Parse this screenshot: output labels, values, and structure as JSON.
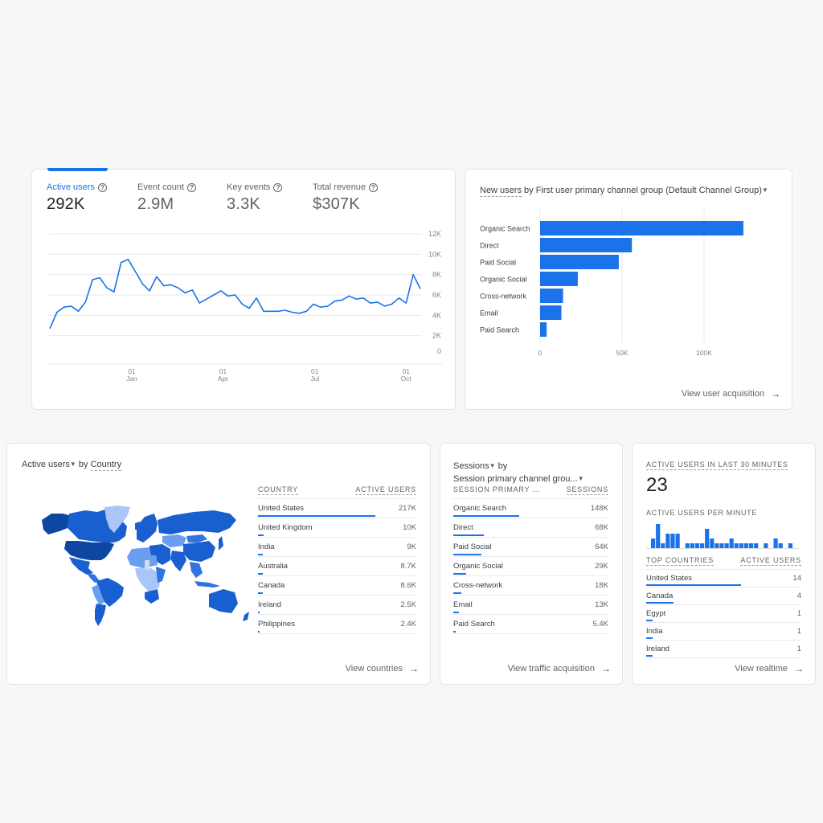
{
  "overview": {
    "metrics": [
      {
        "label": "Active users",
        "value": "292K",
        "active": true
      },
      {
        "label": "Event count",
        "value": "2.9M",
        "active": false
      },
      {
        "label": "Key events",
        "value": "3.3K",
        "active": false
      },
      {
        "label": "Total revenue",
        "value": "$307K",
        "active": false
      }
    ],
    "help_icon": "help-circle-icon"
  },
  "new_users_card": {
    "title_metric": "New users",
    "title_rest": " by First user primary channel group (Default Channel Group)",
    "view_link": "View user acquisition",
    "arrow_icon": "arrow-right-icon"
  },
  "country_card": {
    "title_metric": "Active users",
    "title_by": " by ",
    "title_dim": "Country",
    "col_country": "COUNTRY",
    "col_users": "ACTIVE USERS",
    "rows": [
      {
        "name": "United States",
        "value": "217K",
        "share": 1.0
      },
      {
        "name": "United Kingdom",
        "value": "10K",
        "share": 0.046
      },
      {
        "name": "India",
        "value": "9K",
        "share": 0.041
      },
      {
        "name": "Australia",
        "value": "8.7K",
        "share": 0.04
      },
      {
        "name": "Canada",
        "value": "8.6K",
        "share": 0.04
      },
      {
        "name": "Ireland",
        "value": "2.5K",
        "share": 0.012
      },
      {
        "name": "Philippines",
        "value": "2.4K",
        "share": 0.011
      }
    ],
    "view_link": "View countries",
    "map_colors": {
      "darkest": "#0d47a1",
      "dark": "#1a5fd0",
      "mid": "#2f74e0",
      "light": "#6c9ef0",
      "lighter": "#a9c6f7",
      "none": "#d7dbe0"
    }
  },
  "sessions_card": {
    "title_metric": "Sessions",
    "title_by": " by",
    "title_dim": "Session primary channel grou...",
    "col_dim": "SESSION PRIMARY ...",
    "col_val": "SESSIONS",
    "rows": [
      {
        "name": "Organic Search",
        "value": "148K",
        "share": 1.0
      },
      {
        "name": "Direct",
        "value": "68K",
        "share": 0.46
      },
      {
        "name": "Paid Social",
        "value": "64K",
        "share": 0.43
      },
      {
        "name": "Organic Social",
        "value": "29K",
        "share": 0.2
      },
      {
        "name": "Cross-network",
        "value": "18K",
        "share": 0.12
      },
      {
        "name": "Email",
        "value": "13K",
        "share": 0.09
      },
      {
        "name": "Paid Search",
        "value": "5.4K",
        "share": 0.036
      }
    ],
    "view_link": "View traffic acquisition"
  },
  "realtime_card": {
    "title": "ACTIVE USERS IN LAST 30 MINUTES",
    "value": "23",
    "per_minute_label": "ACTIVE USERS PER MINUTE",
    "per_minute": [
      2,
      5,
      1,
      3,
      3,
      3,
      0,
      1,
      1,
      1,
      1,
      4,
      2,
      1,
      1,
      1,
      2,
      1,
      1,
      1,
      1,
      1,
      0,
      1,
      0,
      2,
      1,
      0,
      1,
      0
    ],
    "col_country": "TOP COUNTRIES",
    "col_users": "ACTIVE USERS",
    "rows": [
      {
        "name": "United States",
        "value": "14",
        "share": 1.0
      },
      {
        "name": "Canada",
        "value": "4",
        "share": 0.29
      },
      {
        "name": "Egypt",
        "value": "1",
        "share": 0.07
      },
      {
        "name": "India",
        "value": "1",
        "share": 0.07
      },
      {
        "name": "Ireland",
        "value": "1",
        "share": 0.07
      }
    ],
    "view_link": "View realtime"
  },
  "chart_data": [
    {
      "type": "line",
      "title": "Active users",
      "xlabel": "",
      "ylabel": "",
      "ylim": [
        0,
        12000
      ],
      "yticks": [
        "0",
        "2K",
        "4K",
        "6K",
        "8K",
        "10K",
        "12K"
      ],
      "ytick_values": [
        0,
        2000,
        4000,
        6000,
        8000,
        10000,
        12000
      ],
      "xticks": [
        {
          "label": [
            "01",
            "Jan"
          ],
          "index": 11.5
        },
        {
          "label": [
            "01",
            "Apr"
          ],
          "index": 24.3
        },
        {
          "label": [
            "01",
            "Jul"
          ],
          "index": 37.2
        },
        {
          "label": [
            "01",
            "Oct"
          ],
          "index": 50.0
        }
      ],
      "grid": true,
      "series": [
        {
          "name": "Active users",
          "color": "#1a73e8",
          "values": [
            2700,
            4300,
            4800,
            4900,
            4400,
            5300,
            7500,
            7700,
            6700,
            6300,
            9200,
            9500,
            8300,
            7100,
            6400,
            7800,
            6900,
            7000,
            6700,
            6200,
            6500,
            5200,
            5600,
            6000,
            6400,
            5900,
            6000,
            5100,
            4700,
            5700,
            4400,
            4400,
            4400,
            4500,
            4300,
            4200,
            4400,
            5100,
            4800,
            4900,
            5400,
            5500,
            5900,
            5600,
            5700,
            5200,
            5300,
            4900,
            5100,
            5700,
            5200,
            8000,
            6600
          ]
        }
      ]
    },
    {
      "type": "bar",
      "orientation": "horizontal",
      "title": "New users by First user primary channel group (Default Channel Group)",
      "categories": [
        "Organic Search",
        "Direct",
        "Paid Social",
        "Organic Social",
        "Cross-network",
        "Email",
        "Paid Search"
      ],
      "values": [
        124000,
        56000,
        48000,
        23000,
        14000,
        13000,
        4000
      ],
      "xlim": [
        0,
        130000
      ],
      "xticks": [
        "0",
        "50K",
        "100K"
      ],
      "xtick_values": [
        0,
        50000,
        100000
      ],
      "grid": true,
      "color": "#1a73e8"
    },
    {
      "type": "bar",
      "title": "Active users per minute",
      "values": [
        2,
        5,
        1,
        3,
        3,
        3,
        0,
        1,
        1,
        1,
        1,
        4,
        2,
        1,
        1,
        1,
        2,
        1,
        1,
        1,
        1,
        1,
        0,
        1,
        0,
        2,
        1,
        0,
        1,
        0
      ],
      "color": "#1a73e8"
    }
  ]
}
